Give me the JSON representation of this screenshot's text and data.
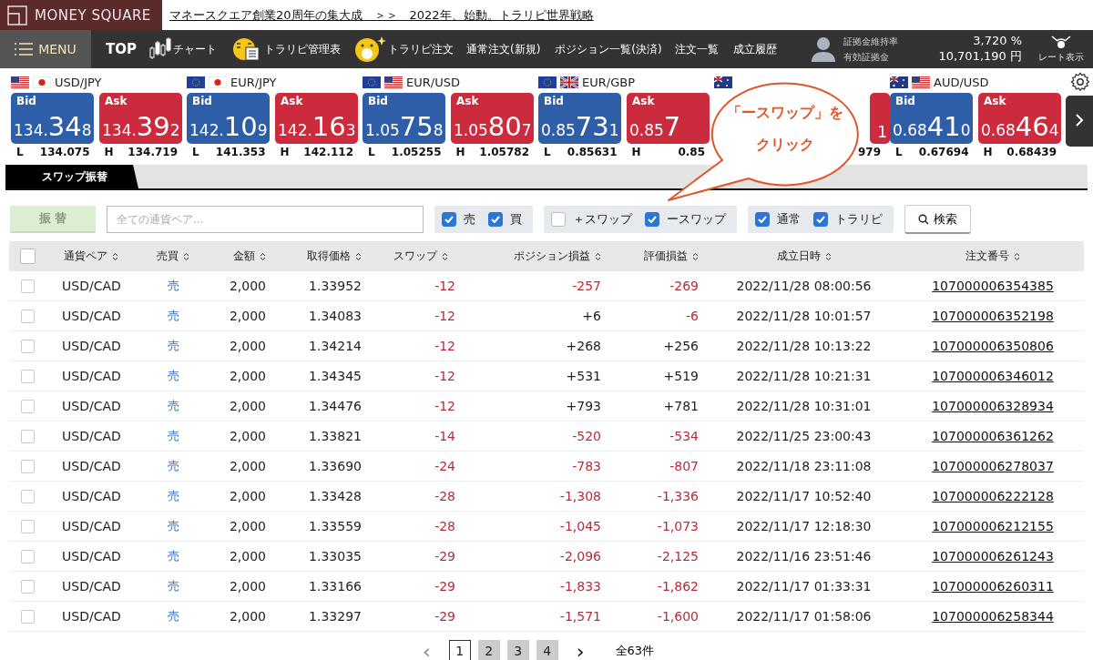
{
  "header": {
    "logo": "MONEY SQUARE",
    "banner": "マネースクエア創業20周年の集大成　＞＞　2022年、始動。トラリピ世界戦略"
  },
  "nav": {
    "menu": "MENU",
    "items": [
      {
        "label": "TOP",
        "kind": "plain"
      },
      {
        "label": "チャート",
        "kind": "chart"
      },
      {
        "label": "トラリピ管理表",
        "kind": "mascot-sheet"
      },
      {
        "label": "トラリピ注文",
        "kind": "mascot-star"
      },
      {
        "label": "通常注文(新規)",
        "kind": "plain"
      },
      {
        "label": "ポジション一覧(決済)",
        "kind": "plain"
      },
      {
        "label": "注文一覧",
        "kind": "plain"
      },
      {
        "label": "成立履歴",
        "kind": "plain"
      }
    ],
    "account": [
      {
        "label": "証拠金維持率",
        "value": "3,720 %"
      },
      {
        "label": "有効証拠金",
        "value": "10,701,190 円"
      }
    ],
    "rate_toggle": "レート表示"
  },
  "quotes": [
    {
      "pair": "USD/JPY",
      "bid": {
        "label": "Bid",
        "prefix": "134.",
        "big": "34",
        "pip": "8"
      },
      "ask": {
        "label": "Ask",
        "prefix": "134.",
        "big": "39",
        "pip": "2"
      },
      "low_label": "L",
      "low": "134.075",
      "high_label": "H",
      "high": "134.719"
    },
    {
      "pair": "EUR/JPY",
      "bid": {
        "label": "Bid",
        "prefix": "142.",
        "big": "10",
        "pip": "9"
      },
      "ask": {
        "label": "Ask",
        "prefix": "142.",
        "big": "16",
        "pip": "3"
      },
      "low_label": "L",
      "low": "141.353",
      "high_label": "H",
      "high": "142.112"
    },
    {
      "pair": "EUR/USD",
      "bid": {
        "label": "Bid",
        "prefix": "1.05",
        "big": "75",
        "pip": "8"
      },
      "ask": {
        "label": "Ask",
        "prefix": "1.05",
        "big": "80",
        "pip": "7"
      },
      "low_label": "L",
      "low": "1.05255",
      "high_label": "H",
      "high": "1.05782"
    },
    {
      "pair": "EUR/GBP",
      "bid": {
        "label": "Bid",
        "prefix": "0.85",
        "big": "73",
        "pip": "1"
      },
      "ask": {
        "label": "Ask",
        "prefix": "0.85",
        "big": "7"
      },
      "low_label": "L",
      "low": "0.85631",
      "high_label": "H",
      "high": "0.85"
    },
    {
      "ask": {
        "pip": "1"
      },
      "high": "979"
    },
    {
      "pair": "AUD/USD",
      "bid": {
        "label": "Bid",
        "prefix": "0.68",
        "big": "41",
        "pip": "0"
      },
      "ask": {
        "label": "Ask",
        "prefix": "0.68",
        "big": "46",
        "pip": "4"
      },
      "low_label": "L",
      "low": "0.67694",
      "high_label": "H",
      "high": "0.68439"
    }
  ],
  "tab": {
    "label": "スワップ振替",
    "selected": true
  },
  "callout": {
    "lines": [
      "「ースワップ」を",
      "クリック"
    ]
  },
  "filters": {
    "transfer_button": {
      "label": "振 替",
      "disabled": true
    },
    "pair_search": {
      "placeholder": "全ての通貨ペア..."
    },
    "groups": [
      [
        {
          "label": "売",
          "checked": true
        },
        {
          "label": "買",
          "checked": true
        }
      ],
      [
        {
          "label": "＋スワップ",
          "checked": false
        },
        {
          "label": "ースワップ",
          "checked": true
        }
      ],
      [
        {
          "label": "通常",
          "checked": true
        },
        {
          "label": "トラリピ",
          "checked": true
        }
      ]
    ],
    "search_button": "検索"
  },
  "table": {
    "select_all": {
      "checked": false
    },
    "columns": [
      "通貨ペア",
      "売買",
      "金額",
      "取得価格",
      "スワップ",
      "ポジション損益",
      "評価損益",
      "成立日時",
      "注文番号"
    ],
    "rows": [
      {
        "checked": false,
        "pair": "USD/CAD",
        "side": "売",
        "amount": "2,000",
        "price": "1.33952",
        "swap": {
          "value": "-12",
          "loss": true
        },
        "pnl": {
          "value": "-257",
          "loss": true
        },
        "eval": {
          "value": "-269",
          "loss": true
        },
        "date": "2022/11/28 08:00:56",
        "order": "107000006354385"
      },
      {
        "checked": false,
        "pair": "USD/CAD",
        "side": "売",
        "amount": "2,000",
        "price": "1.34083",
        "swap": {
          "value": "-12",
          "loss": true
        },
        "pnl": {
          "value": "+6",
          "loss": false
        },
        "eval": {
          "value": "-6",
          "loss": true
        },
        "date": "2022/11/28 10:01:57",
        "order": "107000006352198"
      },
      {
        "checked": false,
        "pair": "USD/CAD",
        "side": "売",
        "amount": "2,000",
        "price": "1.34214",
        "swap": {
          "value": "-12",
          "loss": true
        },
        "pnl": {
          "value": "+268",
          "loss": false
        },
        "eval": {
          "value": "+256",
          "loss": false
        },
        "date": "2022/11/28 10:13:22",
        "order": "107000006350806"
      },
      {
        "checked": false,
        "pair": "USD/CAD",
        "side": "売",
        "amount": "2,000",
        "price": "1.34345",
        "swap": {
          "value": "-12",
          "loss": true
        },
        "pnl": {
          "value": "+531",
          "loss": false
        },
        "eval": {
          "value": "+519",
          "loss": false
        },
        "date": "2022/11/28 10:21:31",
        "order": "107000006346012"
      },
      {
        "checked": false,
        "pair": "USD/CAD",
        "side": "売",
        "amount": "2,000",
        "price": "1.34476",
        "swap": {
          "value": "-12",
          "loss": true
        },
        "pnl": {
          "value": "+793",
          "loss": false
        },
        "eval": {
          "value": "+781",
          "loss": false
        },
        "date": "2022/11/28 10:31:01",
        "order": "107000006328934"
      },
      {
        "checked": false,
        "pair": "USD/CAD",
        "side": "売",
        "amount": "2,000",
        "price": "1.33821",
        "swap": {
          "value": "-14",
          "loss": true
        },
        "pnl": {
          "value": "-520",
          "loss": true
        },
        "eval": {
          "value": "-534",
          "loss": true
        },
        "date": "2022/11/25 23:00:43",
        "order": "107000006361262"
      },
      {
        "checked": false,
        "pair": "USD/CAD",
        "side": "売",
        "amount": "2,000",
        "price": "1.33690",
        "swap": {
          "value": "-24",
          "loss": true
        },
        "pnl": {
          "value": "-783",
          "loss": true
        },
        "eval": {
          "value": "-807",
          "loss": true
        },
        "date": "2022/11/18 23:11:08",
        "order": "107000006278037"
      },
      {
        "checked": false,
        "pair": "USD/CAD",
        "side": "売",
        "amount": "2,000",
        "price": "1.33428",
        "swap": {
          "value": "-28",
          "loss": true
        },
        "pnl": {
          "value": "-1,308",
          "loss": true
        },
        "eval": {
          "value": "-1,336",
          "loss": true
        },
        "date": "2022/11/17 10:52:40",
        "order": "107000006222128"
      },
      {
        "checked": false,
        "pair": "USD/CAD",
        "side": "売",
        "amount": "2,000",
        "price": "1.33559",
        "swap": {
          "value": "-28",
          "loss": true
        },
        "pnl": {
          "value": "-1,045",
          "loss": true
        },
        "eval": {
          "value": "-1,073",
          "loss": true
        },
        "date": "2022/11/17 12:18:30",
        "order": "107000006212155"
      },
      {
        "checked": false,
        "pair": "USD/CAD",
        "side": "売",
        "amount": "2,000",
        "price": "1.33035",
        "swap": {
          "value": "-29",
          "loss": true
        },
        "pnl": {
          "value": "-2,096",
          "loss": true
        },
        "eval": {
          "value": "-2,125",
          "loss": true
        },
        "date": "2022/11/16 23:51:46",
        "order": "107000006261243"
      },
      {
        "checked": false,
        "pair": "USD/CAD",
        "side": "売",
        "amount": "2,000",
        "price": "1.33166",
        "swap": {
          "value": "-29",
          "loss": true
        },
        "pnl": {
          "value": "-1,833",
          "loss": true
        },
        "eval": {
          "value": "-1,862",
          "loss": true
        },
        "date": "2022/11/17 01:33:31",
        "order": "107000006260311"
      },
      {
        "checked": false,
        "pair": "USD/CAD",
        "side": "売",
        "amount": "2,000",
        "price": "1.33297",
        "swap": {
          "value": "-29",
          "loss": true
        },
        "pnl": {
          "value": "-1,571",
          "loss": true
        },
        "eval": {
          "value": "-1,600",
          "loss": true
        },
        "date": "2022/11/17 01:58:06",
        "order": "107000006258344"
      }
    ]
  },
  "pagination": {
    "prev": "‹",
    "pages": [
      {
        "label": "1",
        "selected": true
      },
      {
        "label": "2",
        "selected": false
      },
      {
        "label": "3",
        "selected": false
      },
      {
        "label": "4",
        "selected": false
      }
    ],
    "next": "›",
    "total": "全63件"
  }
}
